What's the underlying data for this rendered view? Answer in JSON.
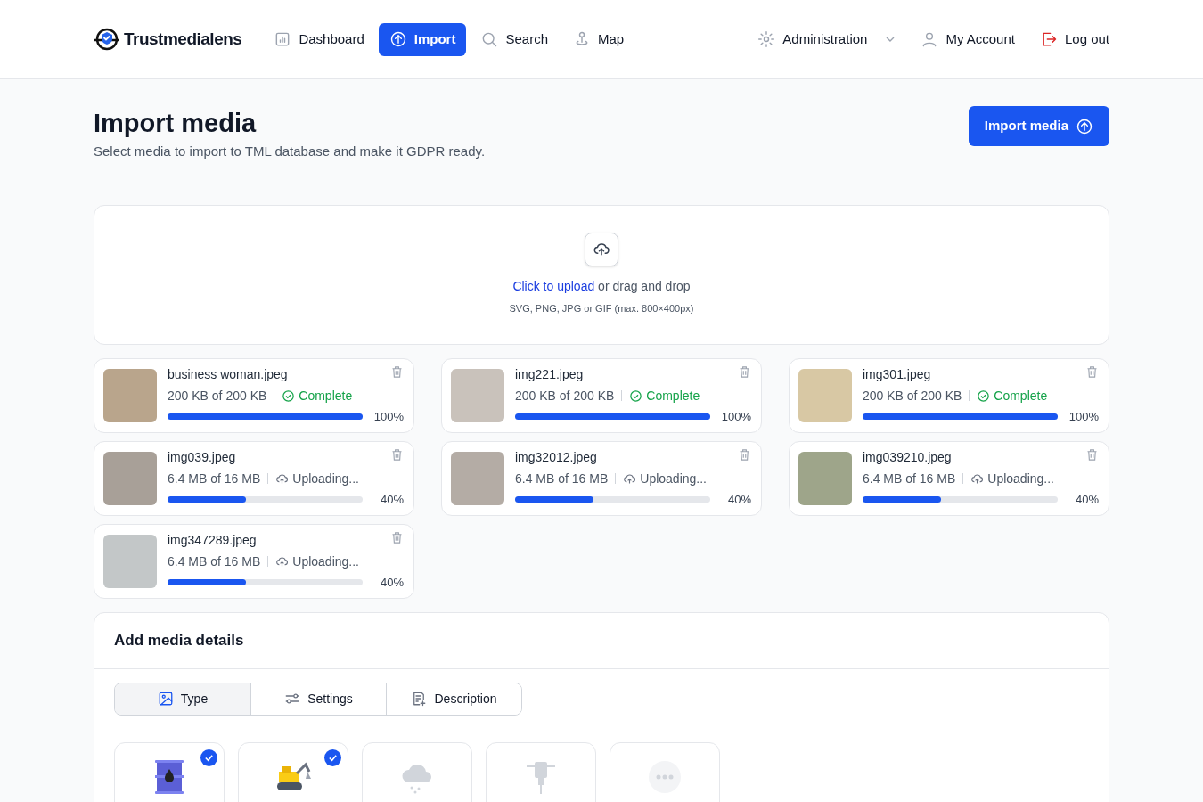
{
  "header": {
    "logo": "Trustmedialens",
    "nav": [
      {
        "label": "Dashboard",
        "kind": "dashboard",
        "selected": false
      },
      {
        "label": "Import",
        "kind": "import",
        "selected": true
      },
      {
        "label": "Search",
        "kind": "search",
        "selected": false
      },
      {
        "label": "Map",
        "kind": "map",
        "selected": false
      }
    ],
    "right": [
      {
        "label": "Administration",
        "kind": "admin"
      },
      {
        "label": "My Account",
        "kind": "account"
      },
      {
        "label": "Log out",
        "kind": "logout"
      }
    ]
  },
  "page": {
    "title": "Import media",
    "subtitle": "Select media to import to TML database and make it GDPR ready.",
    "button": "Import media"
  },
  "upload": {
    "link": "Click to upload",
    "text": "or drag and drop",
    "hint": "SVG, PNG, JPG or GIF (max. 800×400px)"
  },
  "files": [
    {
      "name": "business woman.jpeg",
      "size": "200 KB of 200 KB",
      "status": "Complete",
      "complete": true,
      "level": 1,
      "percent": "100%"
    },
    {
      "name": "img221.jpeg",
      "size": "200 KB of 200 KB",
      "status": "Complete",
      "complete": true,
      "level": 1,
      "percent": "100%"
    },
    {
      "name": "img301.jpeg",
      "size": "200 KB of 200 KB",
      "status": "Complete",
      "complete": true,
      "level": 1,
      "percent": "100%"
    },
    {
      "name": "img039.jpeg",
      "size": "6.4 MB of 16 MB",
      "status": "Uploading...",
      "complete": false,
      "level": 0.4,
      "percent": "40%"
    },
    {
      "name": "img32012.jpeg",
      "size": "6.4 MB of 16 MB",
      "status": "Uploading...",
      "complete": false,
      "level": 0.4,
      "percent": "40%"
    },
    {
      "name": "img039210.jpeg",
      "size": "6.4 MB of 16 MB",
      "status": "Uploading...",
      "complete": false,
      "level": 0.4,
      "percent": "40%"
    },
    {
      "name": "img347289.jpeg",
      "size": "6.4 MB of 16 MB",
      "status": "Uploading...",
      "complete": false,
      "level": 0.4,
      "percent": "40%"
    }
  ],
  "details": {
    "title": "Add media details",
    "tabs": [
      {
        "label": "Type",
        "kind": "type",
        "selected": true
      },
      {
        "label": "Settings",
        "kind": "settings",
        "selected": false
      },
      {
        "label": "Description",
        "kind": "description",
        "selected": false
      }
    ],
    "types": [
      {
        "kind": "barrel",
        "checked": true
      },
      {
        "kind": "excavator",
        "checked": true
      },
      {
        "kind": "rain",
        "checked": false
      },
      {
        "kind": "jackhammer",
        "checked": false
      },
      {
        "kind": "more",
        "checked": false
      }
    ]
  }
}
